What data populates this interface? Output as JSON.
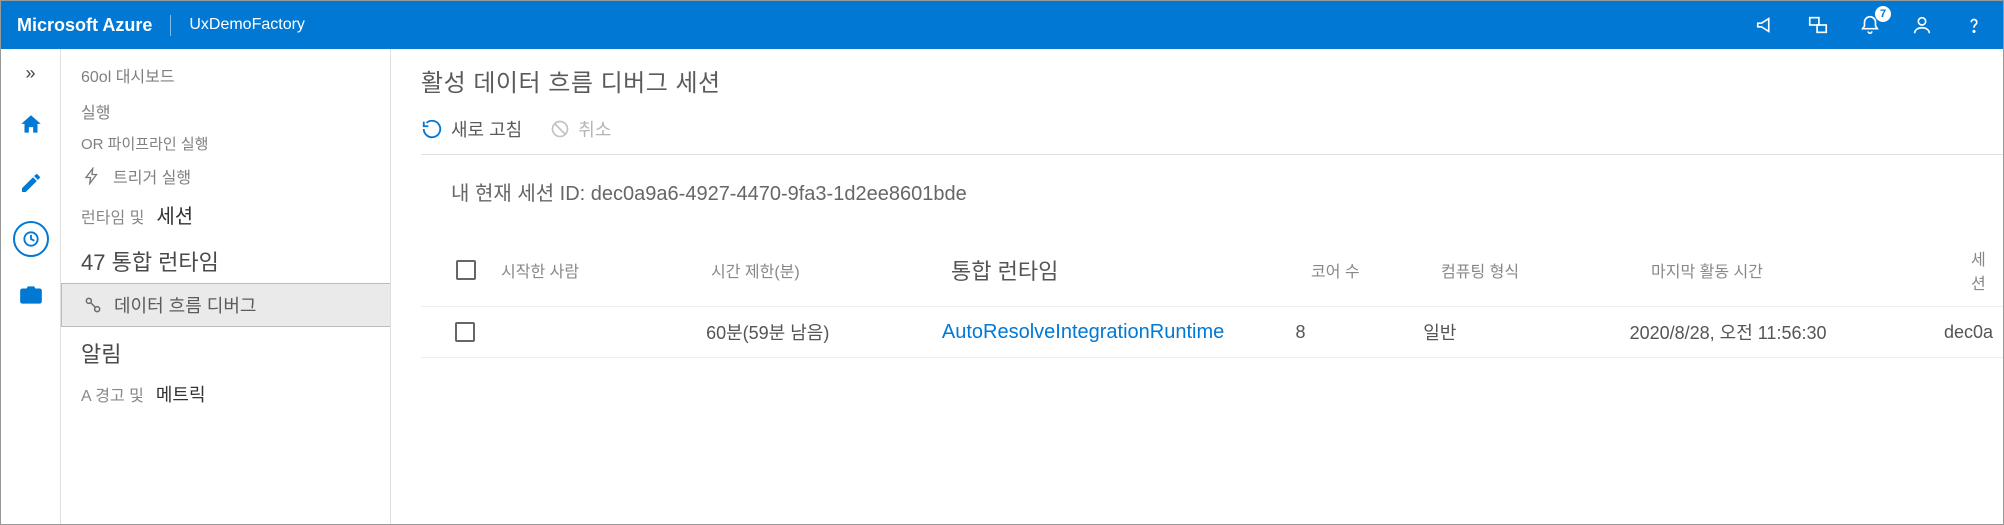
{
  "header": {
    "brand": "Microsoft Azure",
    "workspace": "UxDemoFactory",
    "notification_badge": "7"
  },
  "sidebar": {
    "dashboard": "60ol 대시보드",
    "run": "실행",
    "or_pipeline_run": "OR 파이프라인 실행",
    "trigger_run": "트리거 실행",
    "runtime_and": "런타임 및",
    "session": "세션",
    "integration_runtime": "47 통합 런타임",
    "dataflow_debug": "데이터 흐름 디버그",
    "alerts": "알림",
    "warnings_and": "A 경고 및",
    "metrics": "메트릭"
  },
  "main": {
    "title": "활성 데이터 흐름 디버그 세션",
    "refresh": "새로 고침",
    "cancel": "취소",
    "session_prefix": "내 현재 세션 ID: ",
    "session_id": "dec0a9a6-4927-4470-9fa3-1d2ee8601bde"
  },
  "columns": {
    "started_by": "시작한 사람",
    "time_limit": "시간 제한(분)",
    "integration_runtime": "통합 런타임",
    "cores": "코어 수",
    "compute_type": "컴퓨팅 형식",
    "last_activity": "마지막 활동 시간",
    "session": "세션"
  },
  "rows": [
    {
      "time_limit": "60분(59분 남음)",
      "integration_runtime": "AutoResolveIntegrationRuntime",
      "cores": "8",
      "compute_type": "일반",
      "last_activity": "2020/8/28, 오전 11:56:30",
      "session": "dec0a"
    }
  ]
}
